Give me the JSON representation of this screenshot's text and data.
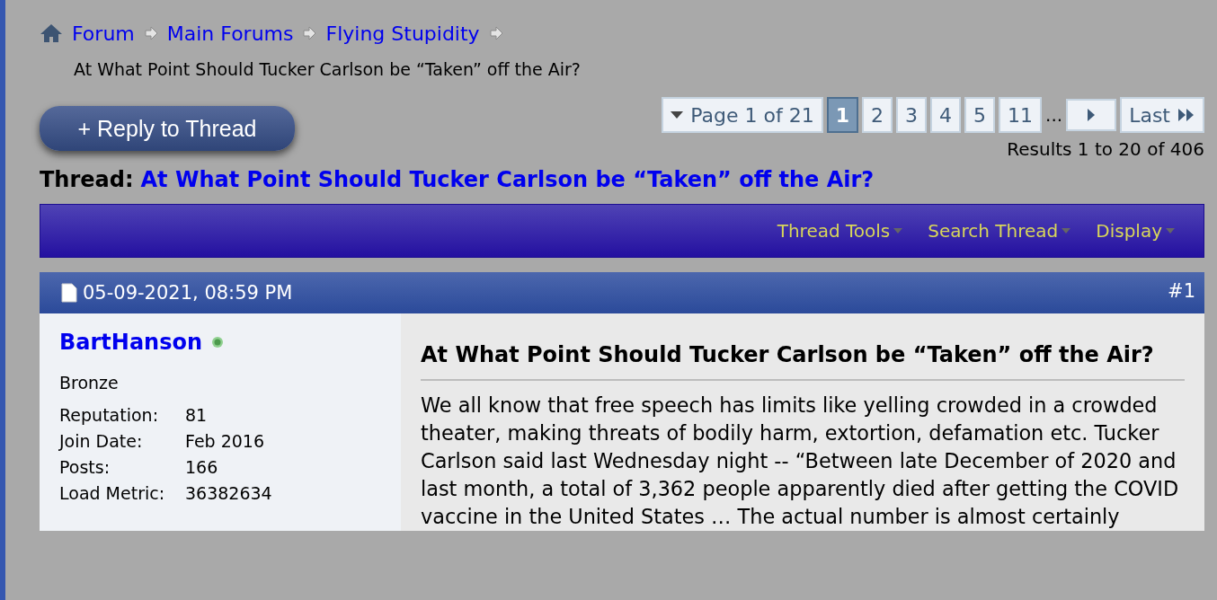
{
  "breadcrumb": {
    "items": [
      "Forum",
      "Main Forums",
      "Flying Stupidity"
    ],
    "current": "At What Point Should Tucker Carlson be “Taken” off the Air?"
  },
  "reply_button": "+ Reply to Thread",
  "pagination": {
    "page_label": "Page 1 of 21",
    "pages": [
      {
        "label": "1",
        "selected": true
      },
      {
        "label": "2",
        "selected": false
      },
      {
        "label": "3",
        "selected": false
      },
      {
        "label": "4",
        "selected": false
      },
      {
        "label": "5",
        "selected": false
      },
      {
        "label": "11",
        "selected": false
      }
    ],
    "ellipsis": "...",
    "last": "Last"
  },
  "results": "Results 1 to 20 of 406",
  "thread": {
    "prefix": "Thread:",
    "title": "At What Point Should Tucker Carlson be “Taken” off the Air?"
  },
  "toolbar": [
    "Thread Tools",
    "Search Thread",
    "Display"
  ],
  "post": {
    "date": "05-09-2021, 08:59 PM",
    "number": "#1",
    "author": {
      "name": "BartHanson",
      "online": true,
      "rank": "Bronze",
      "fields": [
        {
          "label": "Reputation:",
          "value": "81"
        },
        {
          "label": "Join Date:",
          "value": "Feb 2016"
        },
        {
          "label": "Posts:",
          "value": "166"
        },
        {
          "label": "Load Metric:",
          "value": "36382634"
        }
      ]
    },
    "title": "At What Point Should Tucker Carlson be “Taken” off the Air?",
    "body": "We all know that free speech has limits like yelling crowded in a crowded theater, making threats of bodily harm, extortion, defamation etc. Tucker Carlson said last Wednesday night -- “Between late December of 2020 and last month, a total of 3,362 people apparently died after getting the COVID vaccine in the United States … The actual number is almost certainly"
  }
}
